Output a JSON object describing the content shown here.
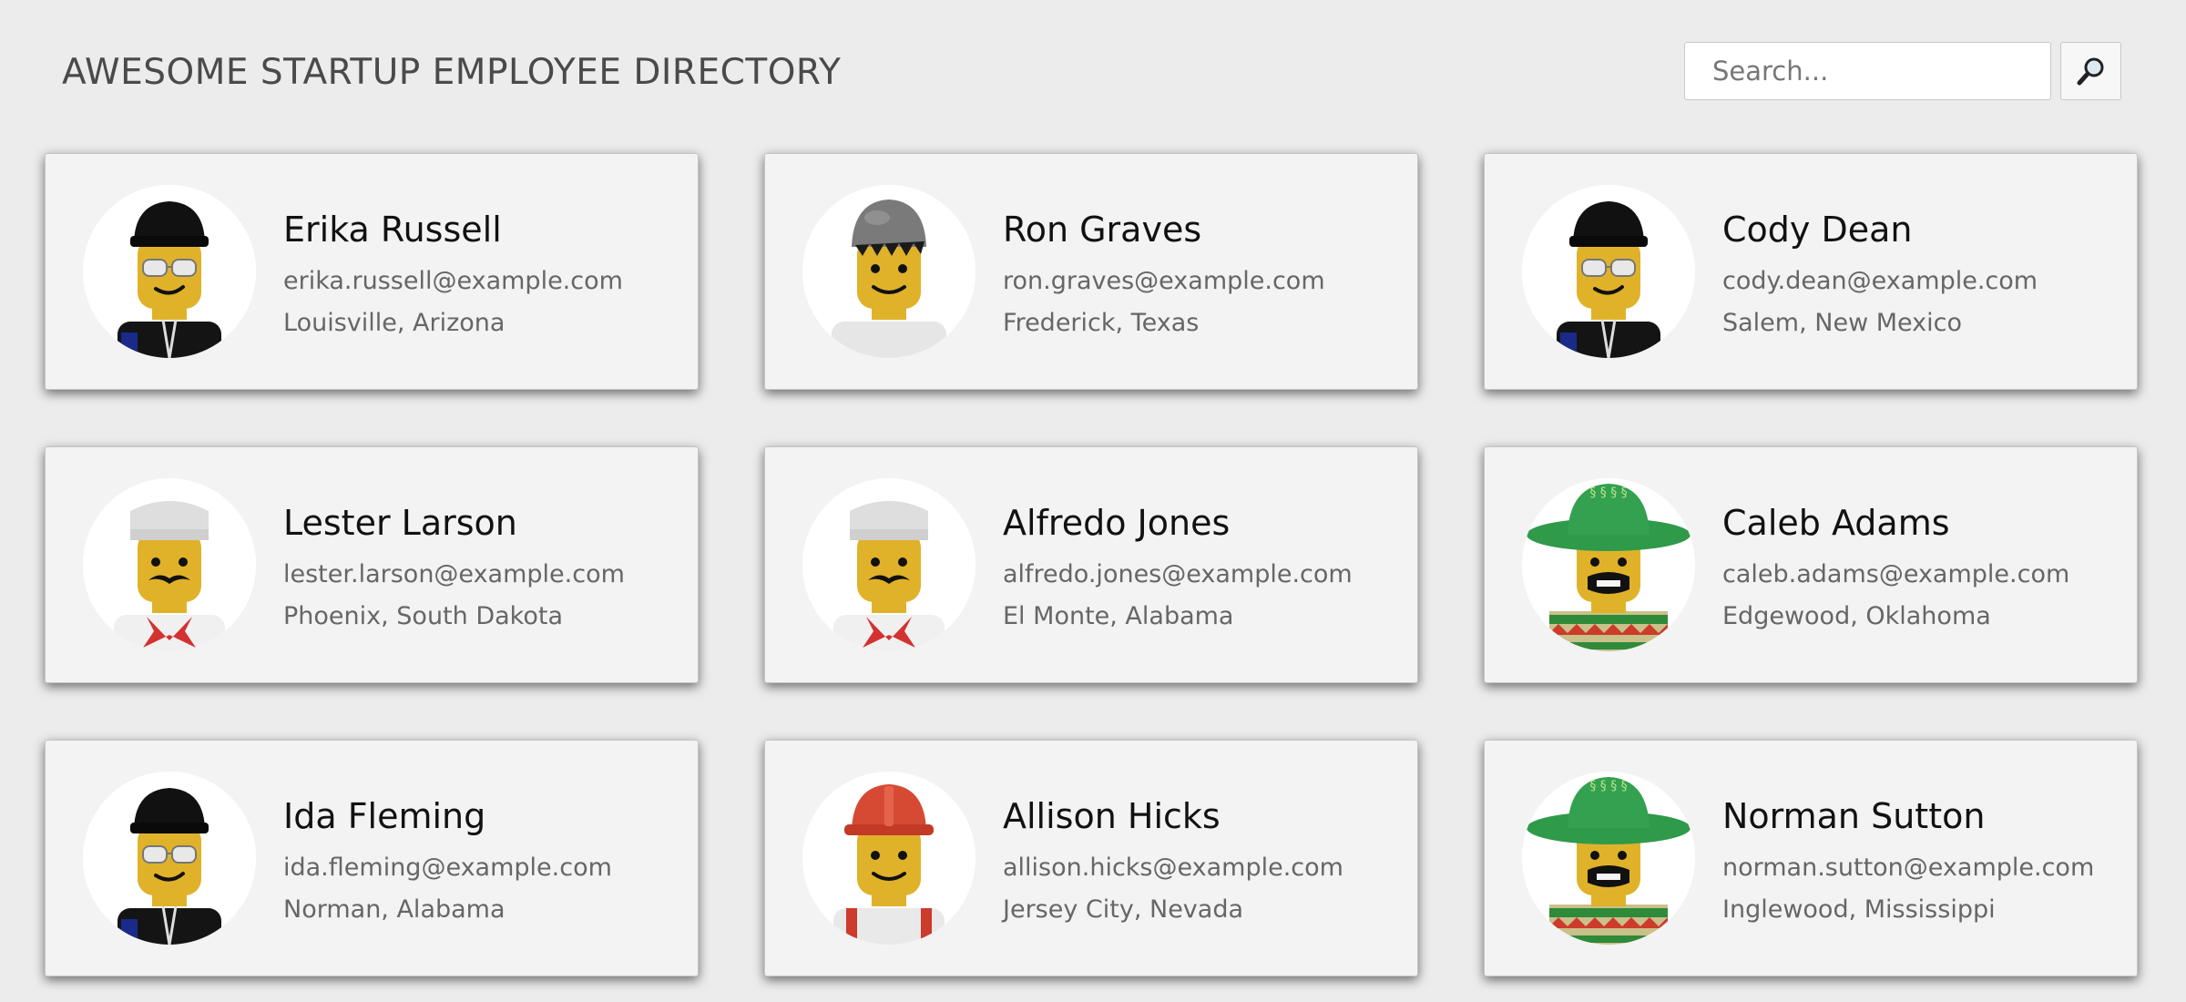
{
  "header": {
    "title": "AWESOME STARTUP EMPLOYEE DIRECTORY"
  },
  "search": {
    "placeholder": "Search...",
    "value": "",
    "button_icon": "magnifier-icon"
  },
  "employees": [
    {
      "name": "Erika Russell",
      "email": "erika.russell@example.com",
      "location": "Louisville, Arizona",
      "avatar": "lego-cap-glasses"
    },
    {
      "name": "Ron Graves",
      "email": "ron.graves@example.com",
      "location": "Frederick, Texas",
      "avatar": "lego-grey-beanie"
    },
    {
      "name": "Cody Dean",
      "email": "cody.dean@example.com",
      "location": "Salem, New Mexico",
      "avatar": "lego-cap-glasses"
    },
    {
      "name": "Lester Larson",
      "email": "lester.larson@example.com",
      "location": "Phoenix, South Dakota",
      "avatar": "lego-chef-mustache"
    },
    {
      "name": "Alfredo Jones",
      "email": "alfredo.jones@example.com",
      "location": "El Monte, Alabama",
      "avatar": "lego-chef-mustache"
    },
    {
      "name": "Caleb Adams",
      "email": "caleb.adams@example.com",
      "location": "Edgewood, Oklahoma",
      "avatar": "lego-sombrero"
    },
    {
      "name": "Ida Fleming",
      "email": "ida.fleming@example.com",
      "location": "Norman, Alabama",
      "avatar": "lego-cap-glasses"
    },
    {
      "name": "Allison Hicks",
      "email": "allison.hicks@example.com",
      "location": "Jersey City, Nevada",
      "avatar": "lego-hard-hat"
    },
    {
      "name": "Norman Sutton",
      "email": "norman.sutton@example.com",
      "location": "Inglewood, Mississippi",
      "avatar": "lego-sombrero"
    }
  ],
  "colors": {
    "background": "#ececec",
    "card": "#f3f3f3",
    "lego_skin": "#e0b22a"
  }
}
